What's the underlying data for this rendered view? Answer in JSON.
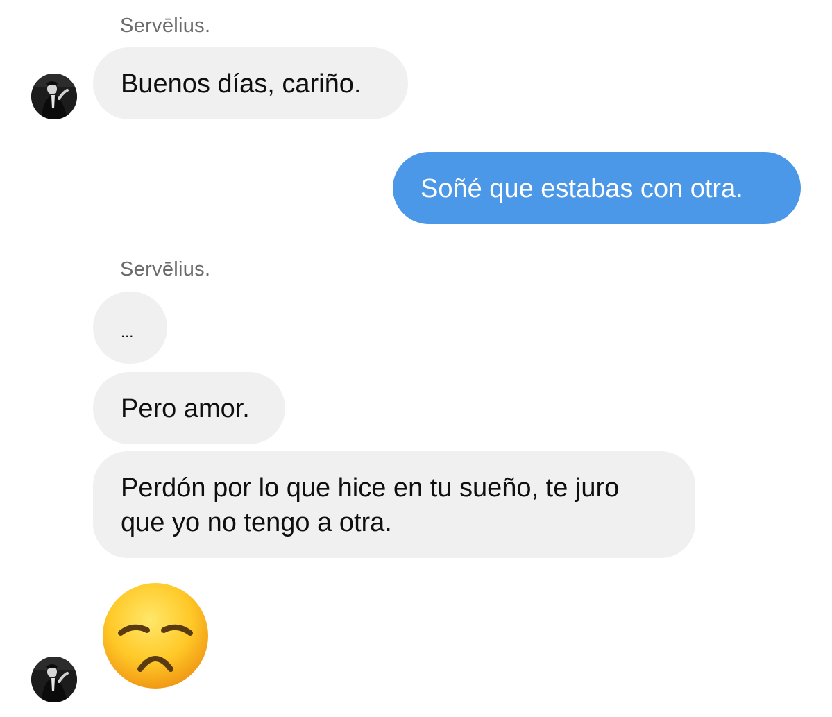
{
  "conversation": {
    "contact_name": "Servēlius.",
    "messages": [
      {
        "from": "contact",
        "text": "Buenos días, cariño."
      },
      {
        "from": "me",
        "text": "Soñé que estabas con otra."
      },
      {
        "from": "contact",
        "text": "..."
      },
      {
        "from": "contact",
        "text": "Pero amor."
      },
      {
        "from": "contact",
        "text": "Perdón por lo que hice en tu sueño, te juro que yo no tengo a otra."
      },
      {
        "from": "contact",
        "emoji": "disappointed-face"
      }
    ]
  },
  "colors": {
    "incoming_bubble": "#f0f0f0",
    "outgoing_bubble": "#4c98e8",
    "sender_name": "#6b6b6b"
  },
  "icons": {
    "avatar": "contact-avatar-photo",
    "emoji": "disappointed-face-emoji"
  }
}
